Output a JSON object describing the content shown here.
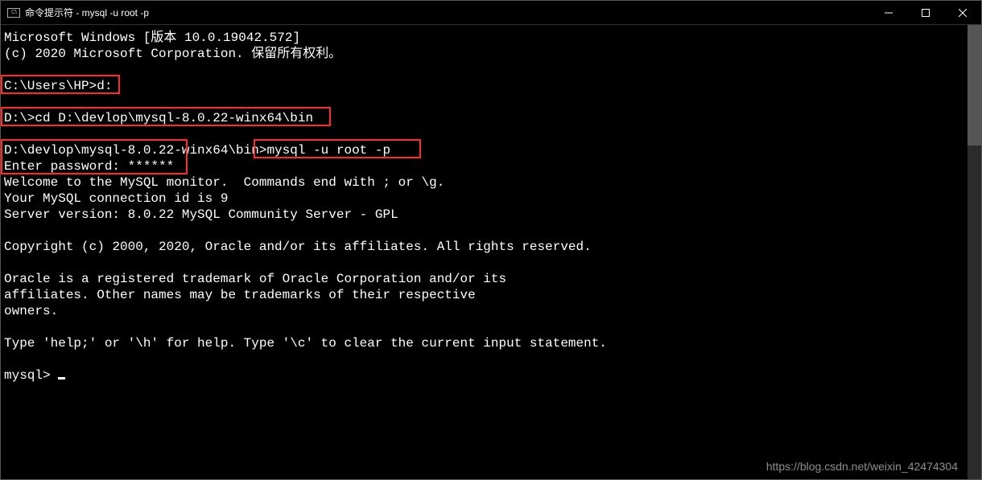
{
  "titlebar": {
    "icon_label": "C:\\",
    "title": "命令提示符 - mysql  -u root -p"
  },
  "term": {
    "l01": "Microsoft Windows [版本 10.0.19042.572]",
    "l02": "(c) 2020 Microsoft Corporation. 保留所有权利。",
    "l03": "",
    "l04": "C:\\Users\\HP>d:",
    "l05": "",
    "l06": "D:\\>cd D:\\devlop\\mysql-8.0.22-winx64\\bin",
    "l07": "",
    "l08a": "D:\\devlop\\mysql-8.0.22-winx64\\bin>",
    "l08b": "mysql -u root -p",
    "l09": "Enter password: ******",
    "l10": "Welcome to the MySQL monitor.  Commands end with ; or \\g.",
    "l11": "Your MySQL connection id is 9",
    "l12": "Server version: 8.0.22 MySQL Community Server - GPL",
    "l13": "",
    "l14": "Copyright (c) 2000, 2020, Oracle and/or its affiliates. All rights reserved.",
    "l15": "",
    "l16": "Oracle is a registered trademark of Oracle Corporation and/or its",
    "l17": "affiliates. Other names may be trademarks of their respective",
    "l18": "owners.",
    "l19": "",
    "l20": "Type 'help;' or '\\h' for help. Type '\\c' to clear the current input statement.",
    "l21": "",
    "l22": "mysql> "
  },
  "watermark": "https://blog.csdn.net/weixin_42474304"
}
